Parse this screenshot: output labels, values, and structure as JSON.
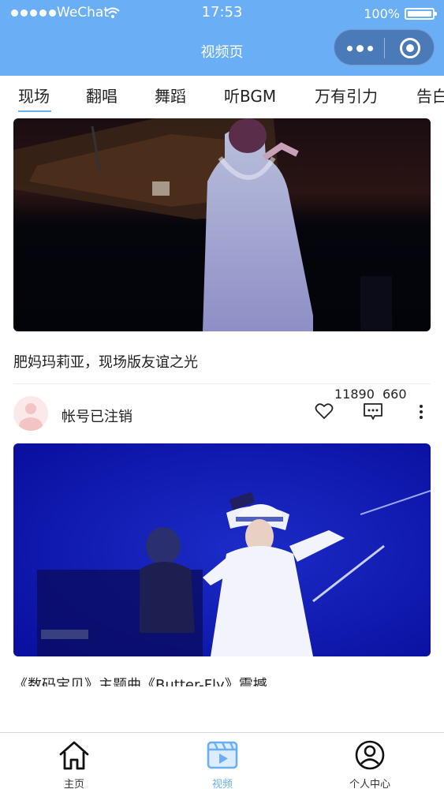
{
  "status_bar": {
    "carrier": "WeChat",
    "time": "17:53",
    "battery": "100%"
  },
  "nav": {
    "title": "视频页"
  },
  "tabs": [
    {
      "label": "现场",
      "active": true
    },
    {
      "label": "翻唱",
      "active": false
    },
    {
      "label": "舞蹈",
      "active": false
    },
    {
      "label": "听BGM",
      "active": false
    },
    {
      "label": "万有引力",
      "active": false
    },
    {
      "label": "告白",
      "active": false
    }
  ],
  "feed": [
    {
      "title": "肥妈玛莉亚，现场版友谊之光",
      "author": "帐号已注销",
      "likes": "11890",
      "comments": "660"
    },
    {
      "title": "《数码宝贝》主题曲《Butter-Fly》震撼"
    }
  ],
  "tabbar": [
    {
      "label": "主页",
      "icon": "home-icon",
      "active": false
    },
    {
      "label": "视频",
      "icon": "video-icon",
      "active": true
    },
    {
      "label": "个人中心",
      "icon": "user-icon",
      "active": false
    }
  ],
  "colors": {
    "accent": "#6aaff5",
    "capsule": "#4a7ab8"
  }
}
